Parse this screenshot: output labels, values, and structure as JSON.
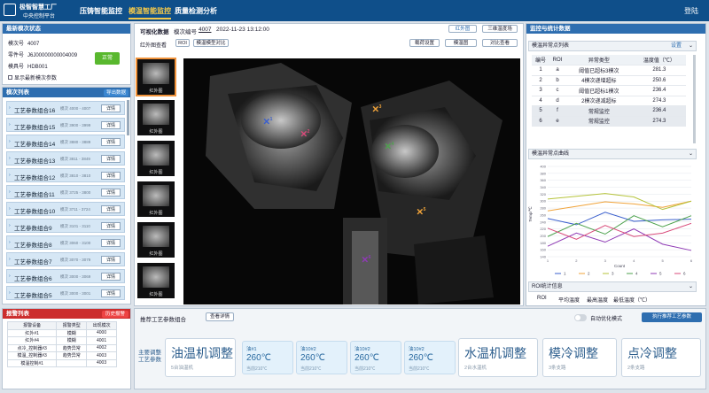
{
  "header": {
    "brand_line1": "极智智慧工厂",
    "brand_line2": "中央控制平台",
    "nav": [
      "压铸智能监控",
      "模温智能监控",
      "质量检测分析"
    ],
    "active_nav": 1,
    "login": "登陆"
  },
  "latest_mold": {
    "title": "最新模次状态",
    "fields": [
      {
        "label": "模次号",
        "value": "4007"
      },
      {
        "label": "零件号",
        "value": "J6J00000000004009"
      },
      {
        "label": "模具号",
        "value": "HDB001"
      }
    ],
    "status": "正常",
    "checkbox_label": "显示最新模次参数"
  },
  "mold_list": {
    "title": "模次列表",
    "export_label": "导出数据",
    "detail_label": "详情",
    "items": [
      {
        "name": "工艺参数组合16",
        "range": "模次 4000 - 4007"
      },
      {
        "name": "工艺参数组合15",
        "range": "模次 3900 - 3999"
      },
      {
        "name": "工艺参数组合14",
        "range": "模次 3880 - 3889"
      },
      {
        "name": "工艺参数组合13",
        "range": "模次 3811 - 3849"
      },
      {
        "name": "工艺参数组合12",
        "range": "模次 3810 - 3810"
      },
      {
        "name": "工艺参数组合11",
        "range": "模次 3725 - 3800"
      },
      {
        "name": "工艺参数组合10",
        "range": "模次 3711 - 3724"
      },
      {
        "name": "工艺参数组合9",
        "range": "模次 3101 - 3110"
      },
      {
        "name": "工艺参数组合8",
        "range": "模次 3060 - 3100"
      },
      {
        "name": "工艺参数组合7",
        "range": "模次 3070 - 3079"
      },
      {
        "name": "工艺参数组合6",
        "range": "模次 3000 - 3069"
      },
      {
        "name": "工艺参数组合5",
        "range": "模次 3000 - 3001"
      }
    ]
  },
  "alarm_list": {
    "title": "报警列表",
    "history_label": "历史报警",
    "headers": [
      "报警设备",
      "报警类型",
      "出现模次"
    ],
    "rows": [
      [
        "红外#1",
        "模糊",
        "4000"
      ],
      [
        "红外#4",
        "模糊",
        "4001"
      ],
      [
        "点冷_控制器#3",
        "趋势异常",
        "4002"
      ],
      [
        "模温_控制器#3",
        "趋势异常",
        "4003"
      ],
      [
        "模温控制#1",
        "",
        "4003"
      ]
    ]
  },
  "visual": {
    "title": "可视化数据",
    "mold_label": "模次编号",
    "mold_no": "4007",
    "timestamp": "2022-11-23 13:12:00",
    "btn_ir": "红外图",
    "btn_3d": "三维温度场",
    "ir_label": "红外图查看",
    "roi_label": "ROI",
    "compare_label": "模温模型对比",
    "load_label": "载荷设置",
    "time_label": "模温图",
    "contrast_label": "对比查看",
    "thumb_label": "红外图",
    "markers": [
      "1",
      "2",
      "3",
      "4",
      "5",
      "6"
    ]
  },
  "recommend": {
    "title": "推荐工艺参数组合",
    "view_label": "查看详情",
    "auto_label": "自动优化模式",
    "exec_label": "执行推荐工艺参数",
    "main_label": "主要调整工艺参数",
    "oil": {
      "title": "油温机调整",
      "sub": "5台油温机"
    },
    "tiles": [
      {
        "name": "油#1",
        "temp": "260℃",
        "cur": "当前210℃"
      },
      {
        "name": "油10#2",
        "temp": "260℃",
        "cur": "当前210℃"
      },
      {
        "name": "油10#2",
        "temp": "260℃",
        "cur": "当前210℃"
      },
      {
        "name": "油10#2",
        "temp": "260℃",
        "cur": "当前210℃"
      }
    ],
    "water": {
      "title": "水温机调整",
      "sub": "2台水温机"
    },
    "mold": {
      "title": "模冷调整",
      "sub": "3条支路"
    },
    "spot": {
      "title": "点冷调整",
      "sub": "2条支路"
    }
  },
  "stats": {
    "title": "监控与统计数据",
    "abnormal_title": "模温异常点列表",
    "settings_label": "设置",
    "headers": [
      "编号",
      "ROI",
      "异常类型",
      "温度值（℃）"
    ],
    "rows": [
      [
        "1",
        "a",
        "阈值已超标3模次",
        "281.3"
      ],
      [
        "2",
        "b",
        "4模次递增超标",
        "250.6"
      ],
      [
        "3",
        "c",
        "阈值已超标1模次",
        "236.4"
      ],
      [
        "4",
        "d",
        "2模次递减超标",
        "274.3"
      ],
      [
        "5",
        "f",
        "常规监控",
        "236.4"
      ],
      [
        "6",
        "e",
        "常规监控",
        "274.3"
      ]
    ],
    "curve_title": "模温异常点曲线",
    "roi_title": "ROI统计信息",
    "roi_headers": [
      "ROI",
      "平均温度",
      "最高温度",
      "最低温度（℃）"
    ]
  },
  "chart_data": {
    "type": "line",
    "xlabel": "Count",
    "ylabel": "Temp/℃",
    "ylim": [
      140,
      400
    ],
    "yticks": [
      140,
      160,
      180,
      200,
      220,
      240,
      260,
      280,
      300,
      320,
      340,
      360,
      380,
      400
    ],
    "x": [
      1,
      2,
      3,
      4,
      5,
      6
    ],
    "series": [
      {
        "name": "1",
        "color": "#3a5fcd",
        "values": [
          250,
          232,
          268,
          242,
          246,
          248
        ]
      },
      {
        "name": "2",
        "color": "#f0a33a",
        "values": [
          272,
          285,
          298,
          292,
          282,
          300
        ]
      },
      {
        "name": "3",
        "color": "#b5c33a",
        "values": [
          306,
          314,
          322,
          312,
          276,
          300
        ]
      },
      {
        "name": "4",
        "color": "#4ea24e",
        "values": [
          198,
          236,
          205,
          258,
          226,
          258
        ]
      },
      {
        "name": "5",
        "color": "#8f3ab5",
        "values": [
          170,
          208,
          182,
          220,
          176,
          158
        ]
      },
      {
        "name": "6",
        "color": "#d84a7a",
        "values": [
          222,
          190,
          230,
          198,
          208,
          236
        ]
      }
    ]
  }
}
